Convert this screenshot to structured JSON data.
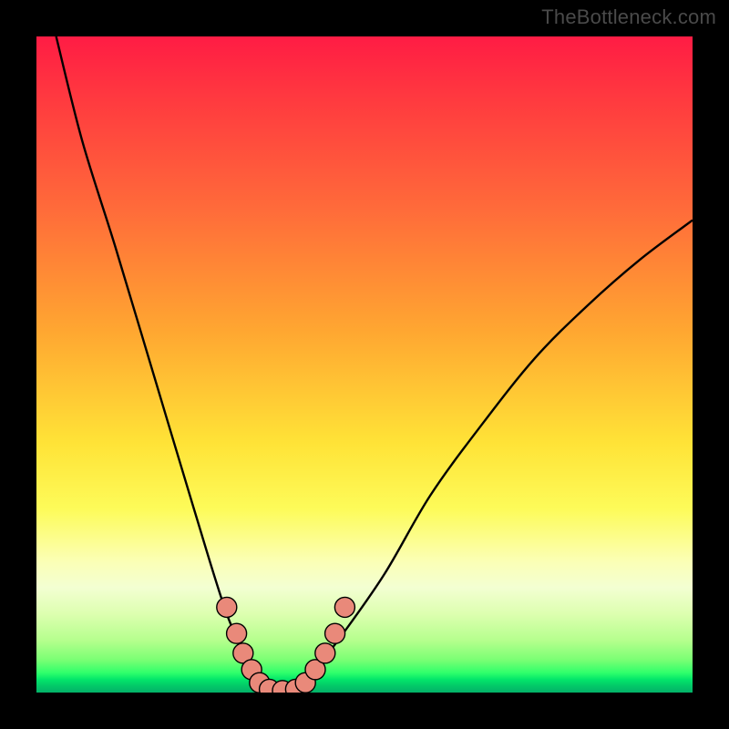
{
  "watermark": {
    "text": "TheBottleneck.com"
  },
  "colors": {
    "background": "#000000",
    "curve_stroke": "#000000",
    "marker_fill": "#E9897A",
    "marker_stroke": "#000000"
  },
  "chart_data": {
    "type": "line",
    "title": "",
    "xlabel": "",
    "ylabel": "",
    "xlim": [
      0,
      100
    ],
    "ylim": [
      0,
      100
    ],
    "grid": false,
    "series": [
      {
        "name": "bottleneck-curve",
        "x": [
          3,
          7,
          12,
          18,
          24,
          29,
          32,
          34,
          36,
          38,
          40,
          42,
          46,
          53,
          60,
          68,
          76,
          84,
          92,
          100
        ],
        "y": [
          100,
          84,
          68,
          48,
          28,
          12,
          6,
          3,
          0,
          0,
          0,
          3,
          8,
          18,
          30,
          41,
          51,
          59,
          66,
          72
        ]
      }
    ],
    "markers": [
      {
        "x": 29.0,
        "y": 13.0
      },
      {
        "x": 30.5,
        "y": 9.0
      },
      {
        "x": 31.5,
        "y": 6.0
      },
      {
        "x": 32.8,
        "y": 3.5
      },
      {
        "x": 34.0,
        "y": 1.5
      },
      {
        "x": 35.5,
        "y": 0.5
      },
      {
        "x": 37.5,
        "y": 0.3
      },
      {
        "x": 39.5,
        "y": 0.5
      },
      {
        "x": 41.0,
        "y": 1.5
      },
      {
        "x": 42.5,
        "y": 3.5
      },
      {
        "x": 44.0,
        "y": 6.0
      },
      {
        "x": 45.5,
        "y": 9.0
      },
      {
        "x": 47.0,
        "y": 13.0
      }
    ]
  }
}
